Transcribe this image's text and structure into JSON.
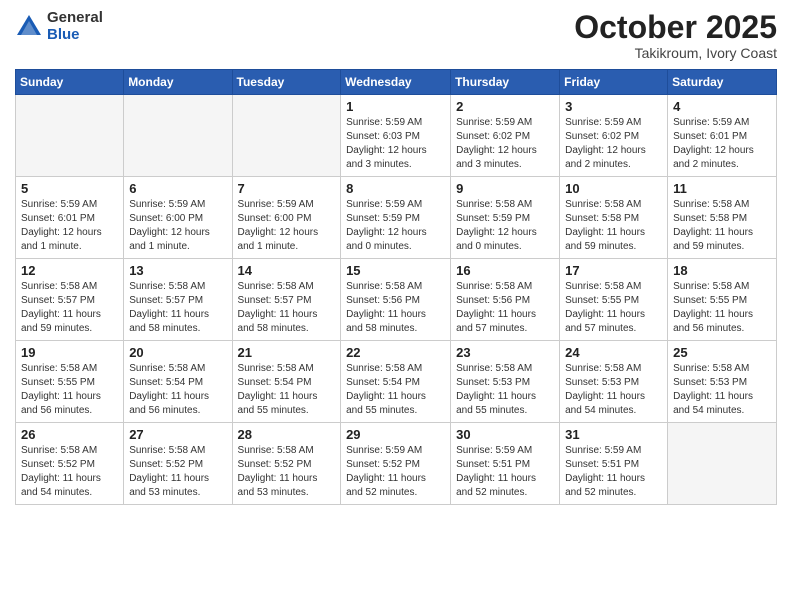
{
  "header": {
    "logo_general": "General",
    "logo_blue": "Blue",
    "month_title": "October 2025",
    "subtitle": "Takikroum, Ivory Coast"
  },
  "days_of_week": [
    "Sunday",
    "Monday",
    "Tuesday",
    "Wednesday",
    "Thursday",
    "Friday",
    "Saturday"
  ],
  "weeks": [
    [
      {
        "day": "",
        "info": ""
      },
      {
        "day": "",
        "info": ""
      },
      {
        "day": "",
        "info": ""
      },
      {
        "day": "1",
        "info": "Sunrise: 5:59 AM\nSunset: 6:03 PM\nDaylight: 12 hours\nand 3 minutes."
      },
      {
        "day": "2",
        "info": "Sunrise: 5:59 AM\nSunset: 6:02 PM\nDaylight: 12 hours\nand 3 minutes."
      },
      {
        "day": "3",
        "info": "Sunrise: 5:59 AM\nSunset: 6:02 PM\nDaylight: 12 hours\nand 2 minutes."
      },
      {
        "day": "4",
        "info": "Sunrise: 5:59 AM\nSunset: 6:01 PM\nDaylight: 12 hours\nand 2 minutes."
      }
    ],
    [
      {
        "day": "5",
        "info": "Sunrise: 5:59 AM\nSunset: 6:01 PM\nDaylight: 12 hours\nand 1 minute."
      },
      {
        "day": "6",
        "info": "Sunrise: 5:59 AM\nSunset: 6:00 PM\nDaylight: 12 hours\nand 1 minute."
      },
      {
        "day": "7",
        "info": "Sunrise: 5:59 AM\nSunset: 6:00 PM\nDaylight: 12 hours\nand 1 minute."
      },
      {
        "day": "8",
        "info": "Sunrise: 5:59 AM\nSunset: 5:59 PM\nDaylight: 12 hours\nand 0 minutes."
      },
      {
        "day": "9",
        "info": "Sunrise: 5:58 AM\nSunset: 5:59 PM\nDaylight: 12 hours\nand 0 minutes."
      },
      {
        "day": "10",
        "info": "Sunrise: 5:58 AM\nSunset: 5:58 PM\nDaylight: 11 hours\nand 59 minutes."
      },
      {
        "day": "11",
        "info": "Sunrise: 5:58 AM\nSunset: 5:58 PM\nDaylight: 11 hours\nand 59 minutes."
      }
    ],
    [
      {
        "day": "12",
        "info": "Sunrise: 5:58 AM\nSunset: 5:57 PM\nDaylight: 11 hours\nand 59 minutes."
      },
      {
        "day": "13",
        "info": "Sunrise: 5:58 AM\nSunset: 5:57 PM\nDaylight: 11 hours\nand 58 minutes."
      },
      {
        "day": "14",
        "info": "Sunrise: 5:58 AM\nSunset: 5:57 PM\nDaylight: 11 hours\nand 58 minutes."
      },
      {
        "day": "15",
        "info": "Sunrise: 5:58 AM\nSunset: 5:56 PM\nDaylight: 11 hours\nand 58 minutes."
      },
      {
        "day": "16",
        "info": "Sunrise: 5:58 AM\nSunset: 5:56 PM\nDaylight: 11 hours\nand 57 minutes."
      },
      {
        "day": "17",
        "info": "Sunrise: 5:58 AM\nSunset: 5:55 PM\nDaylight: 11 hours\nand 57 minutes."
      },
      {
        "day": "18",
        "info": "Sunrise: 5:58 AM\nSunset: 5:55 PM\nDaylight: 11 hours\nand 56 minutes."
      }
    ],
    [
      {
        "day": "19",
        "info": "Sunrise: 5:58 AM\nSunset: 5:55 PM\nDaylight: 11 hours\nand 56 minutes."
      },
      {
        "day": "20",
        "info": "Sunrise: 5:58 AM\nSunset: 5:54 PM\nDaylight: 11 hours\nand 56 minutes."
      },
      {
        "day": "21",
        "info": "Sunrise: 5:58 AM\nSunset: 5:54 PM\nDaylight: 11 hours\nand 55 minutes."
      },
      {
        "day": "22",
        "info": "Sunrise: 5:58 AM\nSunset: 5:54 PM\nDaylight: 11 hours\nand 55 minutes."
      },
      {
        "day": "23",
        "info": "Sunrise: 5:58 AM\nSunset: 5:53 PM\nDaylight: 11 hours\nand 55 minutes."
      },
      {
        "day": "24",
        "info": "Sunrise: 5:58 AM\nSunset: 5:53 PM\nDaylight: 11 hours\nand 54 minutes."
      },
      {
        "day": "25",
        "info": "Sunrise: 5:58 AM\nSunset: 5:53 PM\nDaylight: 11 hours\nand 54 minutes."
      }
    ],
    [
      {
        "day": "26",
        "info": "Sunrise: 5:58 AM\nSunset: 5:52 PM\nDaylight: 11 hours\nand 54 minutes."
      },
      {
        "day": "27",
        "info": "Sunrise: 5:58 AM\nSunset: 5:52 PM\nDaylight: 11 hours\nand 53 minutes."
      },
      {
        "day": "28",
        "info": "Sunrise: 5:58 AM\nSunset: 5:52 PM\nDaylight: 11 hours\nand 53 minutes."
      },
      {
        "day": "29",
        "info": "Sunrise: 5:59 AM\nSunset: 5:52 PM\nDaylight: 11 hours\nand 52 minutes."
      },
      {
        "day": "30",
        "info": "Sunrise: 5:59 AM\nSunset: 5:51 PM\nDaylight: 11 hours\nand 52 minutes."
      },
      {
        "day": "31",
        "info": "Sunrise: 5:59 AM\nSunset: 5:51 PM\nDaylight: 11 hours\nand 52 minutes."
      },
      {
        "day": "",
        "info": ""
      }
    ]
  ]
}
